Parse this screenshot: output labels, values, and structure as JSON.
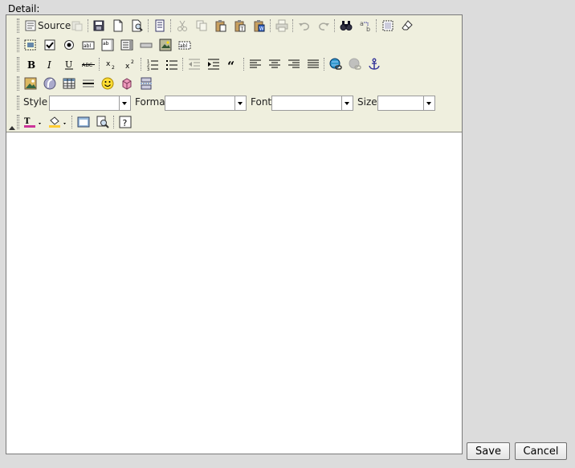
{
  "form": {
    "detail_label": "Detail:"
  },
  "toolbar": {
    "source_label": "Source",
    "style_label": "Style",
    "format_label": "Format",
    "font_label": "Font",
    "size_label": "Size",
    "style_value": "",
    "format_value": "",
    "font_value": "",
    "size_value": ""
  },
  "editor": {
    "content": ""
  },
  "actions": {
    "save_label": "Save",
    "cancel_label": "Cancel"
  }
}
